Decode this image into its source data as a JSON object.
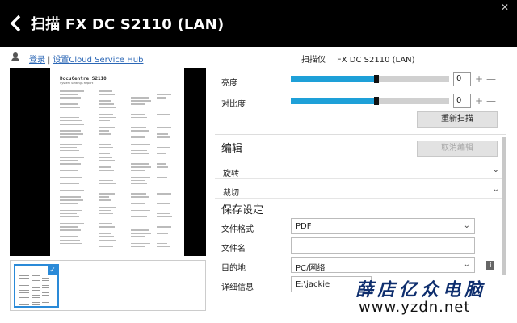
{
  "window": {
    "title": "扫描 FX DC S2110 (LAN)",
    "close_glyph": "✕"
  },
  "toolbar": {
    "login_link": "登录",
    "separator": "|",
    "setup_link": "设置Cloud Service Hub",
    "scanner_label": "扫描仪",
    "scanner_name": "FX DC S2110 (LAN)"
  },
  "preview": {
    "doc_title": "DocuCentre S2110",
    "doc_subtitle": "System Settings Report"
  },
  "adjust": {
    "brightness": {
      "label": "亮度",
      "value": "0",
      "level": 0.54
    },
    "contrast": {
      "label": "对比度",
      "value": "0",
      "level": 0.54
    },
    "rescan_button": "重新扫描"
  },
  "edit": {
    "title": "编辑",
    "cancel_button": "取消编辑",
    "rotate_label": "旋转",
    "crop_label": "裁切"
  },
  "save": {
    "title": "保存设定",
    "format_label": "文件格式",
    "format_value": "PDF",
    "filename_label": "文件名",
    "filename_value": "",
    "destination_label": "目的地",
    "destination_value": "PC/网络",
    "details_label": "详细信息",
    "details_value": "E:\\jackie"
  },
  "watermark": {
    "line1": "薛店亿众电脑",
    "line2": "www.yzdn.net"
  },
  "icons": {
    "back": "back-arrow-icon",
    "user": "user-icon",
    "plus": "+",
    "minus": "—",
    "chevron": "⌄",
    "info": "i",
    "check": "✓"
  },
  "colors": {
    "titlebar": "#000000",
    "slider_fill": "#1ea0d8",
    "link": "#2b67b6",
    "selection": "#2a8ad8"
  }
}
